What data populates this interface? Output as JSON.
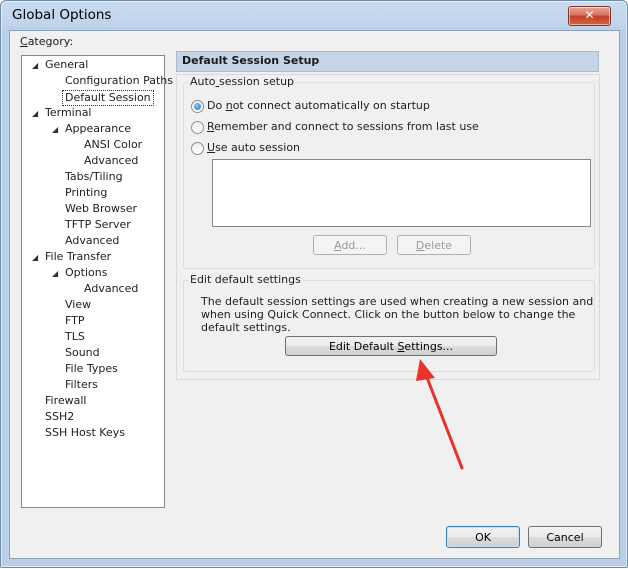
{
  "window": {
    "title": "Global Options",
    "close_glyph": "✕"
  },
  "category_label": "Category:",
  "tree": [
    {
      "label": "General",
      "level": 0,
      "expanded": true
    },
    {
      "label": "Configuration Paths",
      "level": 1
    },
    {
      "label": "Default Session",
      "level": 1,
      "selected": true
    },
    {
      "label": "Terminal",
      "level": 0,
      "expanded": true
    },
    {
      "label": "Appearance",
      "level": 1,
      "expanded": true
    },
    {
      "label": "ANSI Color",
      "level": 2
    },
    {
      "label": "Advanced",
      "level": 2
    },
    {
      "label": "Tabs/Tiling",
      "level": 1
    },
    {
      "label": "Printing",
      "level": 1
    },
    {
      "label": "Web Browser",
      "level": 1
    },
    {
      "label": "TFTP Server",
      "level": 1
    },
    {
      "label": "Advanced",
      "level": 1
    },
    {
      "label": "File Transfer",
      "level": 0,
      "expanded": true
    },
    {
      "label": "Options",
      "level": 1,
      "expanded": true
    },
    {
      "label": "Advanced",
      "level": 2
    },
    {
      "label": "View",
      "level": 1
    },
    {
      "label": "FTP",
      "level": 1
    },
    {
      "label": "TLS",
      "level": 1
    },
    {
      "label": "Sound",
      "level": 1
    },
    {
      "label": "File Types",
      "level": 1
    },
    {
      "label": "Filters",
      "level": 1
    },
    {
      "label": "Firewall",
      "level": 0
    },
    {
      "label": "SSH2",
      "level": 0
    },
    {
      "label": "SSH Host Keys",
      "level": 0
    }
  ],
  "panel": {
    "header": "Default Session Setup",
    "auto_group": {
      "title": "Auto session setup",
      "options": [
        {
          "label": "Do not connect automatically on startup",
          "selected": true
        },
        {
          "label": "Remember and connect to sessions from last use",
          "selected": false
        },
        {
          "label": "Use auto session",
          "selected": false
        }
      ],
      "add_label": "Add...",
      "delete_label": "Delete"
    },
    "edit_group": {
      "title": "Edit default settings",
      "description": "The default session settings are used when creating a new session and when using Quick Connect.  Click on the button below to change the default settings.",
      "button_label": "Edit Default Settings..."
    }
  },
  "footer": {
    "ok_label": "OK",
    "cancel_label": "Cancel"
  },
  "colors": {
    "annotation_arrow": "#e8332a",
    "header_bg": "#c5d4e6",
    "selection_radio": "#1a6fc0"
  }
}
